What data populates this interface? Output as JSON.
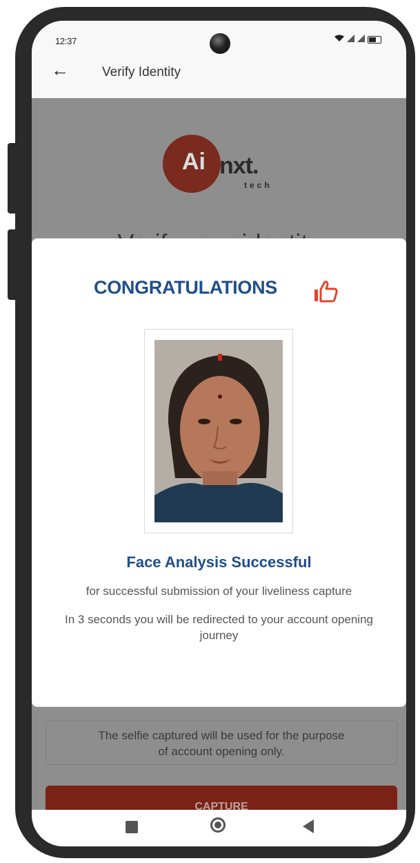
{
  "status_bar": {
    "time": "12:37",
    "icons": [
      "wifi-icon",
      "signal-icon",
      "signal-icon",
      "battery-icon"
    ]
  },
  "app_bar": {
    "back_icon": "back-arrow-icon",
    "title": "Verify Identity"
  },
  "background": {
    "logo_text_ai": "Ai",
    "logo_text_nxt": "nxt.",
    "logo_text_tech": "tech",
    "heading": "Verify your identity",
    "disclaimer_line1": "The selfie captured will be used for the purpose",
    "disclaimer_line2": "of account opening only.",
    "capture_label": "CAPTURE"
  },
  "modal": {
    "title": "CONGRATULATIONS",
    "title_icon": "thumbs-up-icon",
    "subtitle": "Face Analysis Successful",
    "line1": "for successful submission of your liveliness capture",
    "line2": "In 3 seconds you will be redirected to your account opening journey"
  },
  "nav_bar": {
    "icons": [
      "recents-square-icon",
      "home-circle-icon",
      "back-triangle-icon"
    ]
  },
  "colors": {
    "accent_blue": "#1f4e8c",
    "brand_red": "#e2452d",
    "capture_button": "#7a2215",
    "overlay_gray": "#8e8e8e"
  }
}
